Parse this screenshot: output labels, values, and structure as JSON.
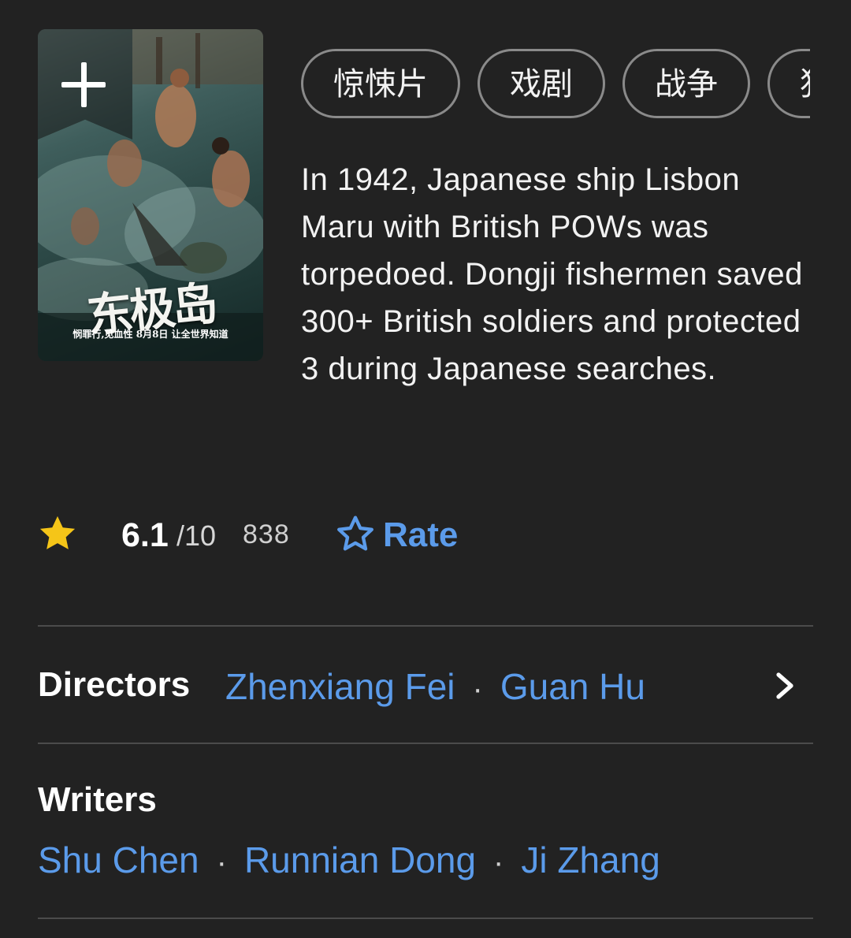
{
  "genres": [
    "惊悚片",
    "戏剧",
    "战争",
    "犯"
  ],
  "description": "In 1942, Japanese ship Lisbon Maru with British POWs was torpedoed. Dongji fishermen saved 300+ British soldiers and protected 3 during Japanese searches.",
  "poster": {
    "title": "东极岛",
    "tagline": "悯罪行,见血性  8月8日  让全世界知道"
  },
  "rating": {
    "value": "6.1",
    "scale": "/10",
    "count": "838",
    "rate_label": "Rate",
    "star_color": "#f5c518",
    "accent_color": "#5b9bea"
  },
  "credits": {
    "directors_label": "Directors",
    "directors": [
      "Zhenxiang Fei",
      "Guan Hu"
    ],
    "writers_label": "Writers",
    "writers": [
      "Shu Chen",
      "Runnian Dong",
      "Ji Zhang"
    ],
    "separator": "·"
  },
  "icons": {
    "add": "plus-icon",
    "rating_star": "star-filled-icon",
    "rate_star": "star-outline-icon",
    "more": "chevron-right-icon"
  }
}
